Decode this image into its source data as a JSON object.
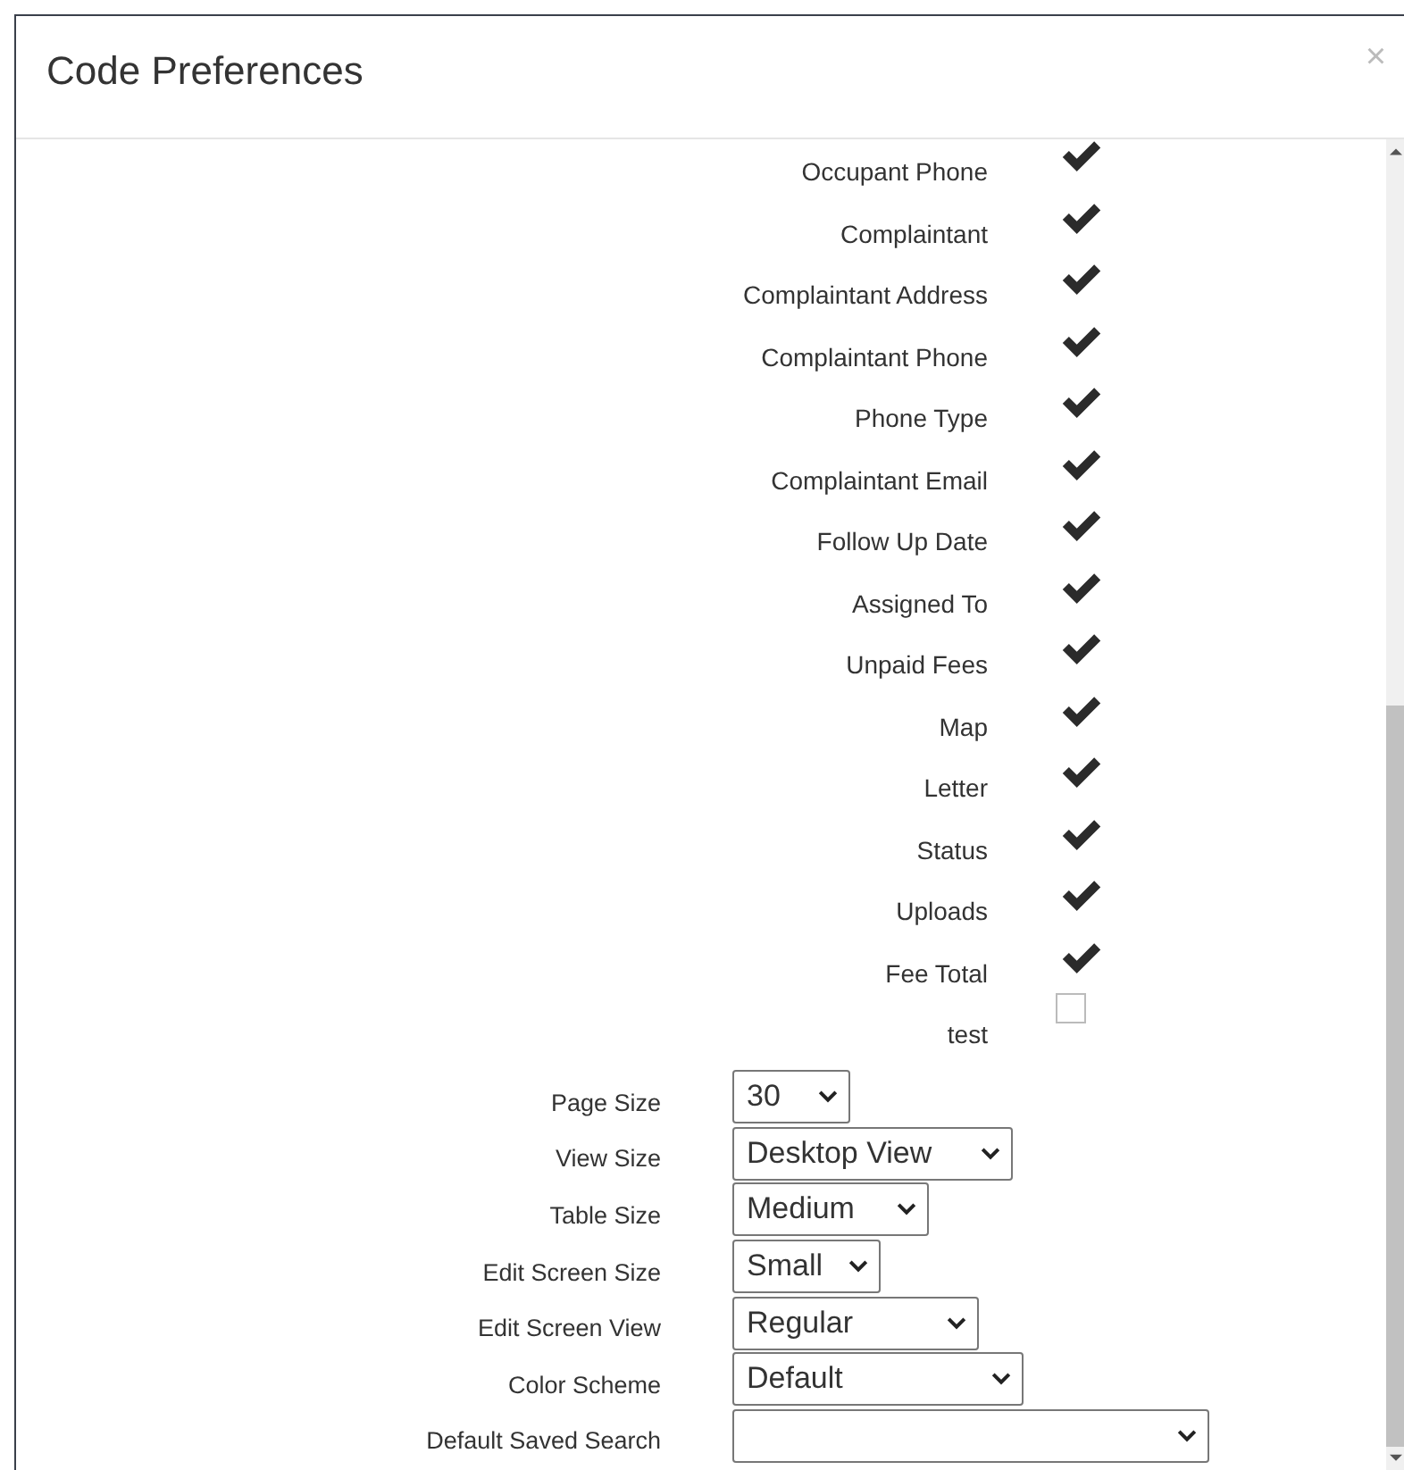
{
  "dialog": {
    "title": "Code Preferences",
    "close": "×"
  },
  "columns": [
    {
      "label": "Occupant Phone",
      "checked": true
    },
    {
      "label": "Complaintant",
      "checked": true
    },
    {
      "label": "Complaintant Address",
      "checked": true
    },
    {
      "label": "Complaintant Phone",
      "checked": true
    },
    {
      "label": "Phone Type",
      "checked": true
    },
    {
      "label": "Complaintant Email",
      "checked": true
    },
    {
      "label": "Follow Up Date",
      "checked": true
    },
    {
      "label": "Assigned To",
      "checked": true
    },
    {
      "label": "Unpaid Fees",
      "checked": true
    },
    {
      "label": "Map",
      "checked": true
    },
    {
      "label": "Letter",
      "checked": true
    },
    {
      "label": "Status",
      "checked": true
    },
    {
      "label": "Uploads",
      "checked": true
    },
    {
      "label": "Fee Total",
      "checked": true
    },
    {
      "label": "test",
      "checked": false
    }
  ],
  "settings": [
    {
      "label": "Page Size",
      "value": "30"
    },
    {
      "label": "View Size",
      "value": "Desktop View"
    },
    {
      "label": "Table Size",
      "value": "Medium"
    },
    {
      "label": "Edit Screen Size",
      "value": "Small"
    },
    {
      "label": "Edit Screen View",
      "value": "Regular"
    },
    {
      "label": "Color Scheme",
      "value": "Default"
    },
    {
      "label": "Default Saved Search"
    }
  ]
}
